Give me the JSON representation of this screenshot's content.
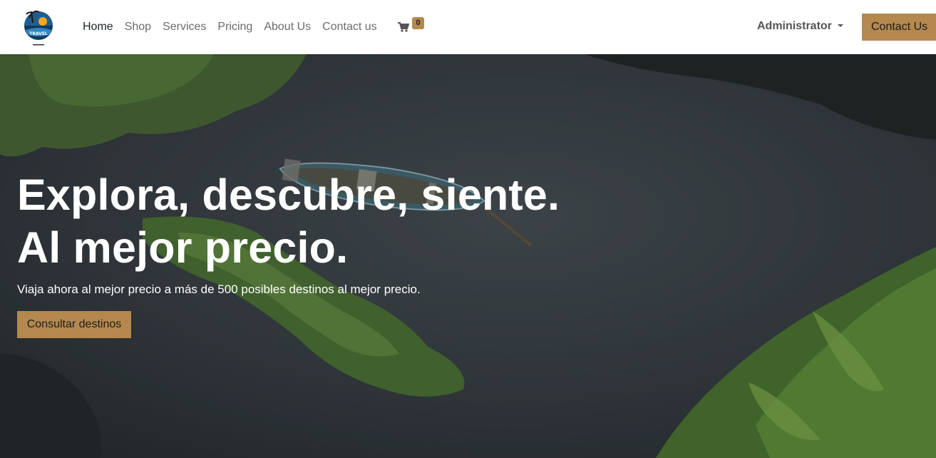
{
  "navbar": {
    "logo_text": "TRAVEL",
    "links": [
      {
        "label": "Home",
        "active": true
      },
      {
        "label": "Shop",
        "active": false
      },
      {
        "label": "Services",
        "active": false
      },
      {
        "label": "Pricing",
        "active": false
      },
      {
        "label": "About Us",
        "active": false
      },
      {
        "label": "Contact us",
        "active": false
      }
    ],
    "cart_count": "0",
    "user_label": "Administrator",
    "cta_label": "Contact Us"
  },
  "hero": {
    "title_line1": "Explora, descubre, siente.",
    "title_line2": "Al mejor precio.",
    "subtitle": "Viaja ahora al mejor precio a más de 500 posibles destinos al mejor precio.",
    "button_label": "Consultar destinos"
  },
  "colors": {
    "accent": "#b4884e",
    "nav_bg": "#ffffff",
    "water": "#3a4247",
    "foliage": "#5e8a34"
  },
  "icons": {
    "cart": "shopping-cart-icon",
    "caret": "caret-down-icon"
  }
}
